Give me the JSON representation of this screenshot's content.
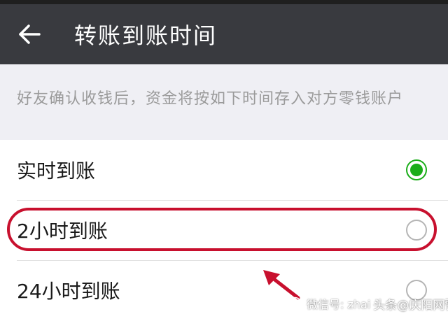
{
  "header": {
    "title": "转账到账时间",
    "back_icon": "arrow-left-icon"
  },
  "info": {
    "text": "好友确认收钱后，资金将按如下时间存入对方零钱账户"
  },
  "options": [
    {
      "label": "实时到账",
      "selected": true
    },
    {
      "label": "2小时到账",
      "selected": false
    },
    {
      "label": "24小时到账",
      "selected": false
    }
  ],
  "watermark": {
    "wechat_label": "微信号: zhai",
    "source": "头条@庆阳网警"
  },
  "colors": {
    "app_bar": "#393a3f",
    "accent_green": "#1aad19",
    "highlight_red": "#c8102e",
    "info_background": "#efeff4"
  }
}
